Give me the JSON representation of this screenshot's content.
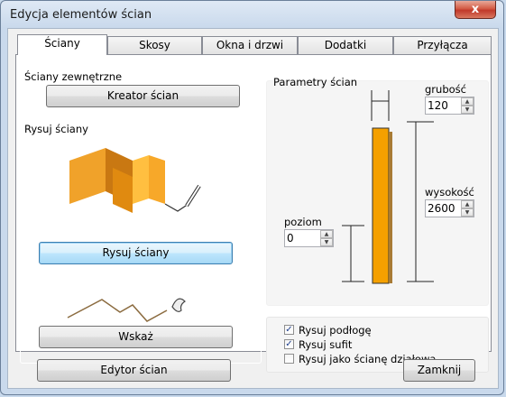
{
  "window": {
    "title": "Edycja elementów ścian",
    "close_glyph": "x"
  },
  "tabs": [
    {
      "label": "Ściany",
      "active": true
    },
    {
      "label": "Skosy",
      "active": false
    },
    {
      "label": "Okna i drzwi",
      "active": false
    },
    {
      "label": "Dodatki",
      "active": false
    },
    {
      "label": "Przyłącza",
      "active": false
    }
  ],
  "exterior_walls": {
    "label": "Ściany zewnętrzne",
    "wizard_button": "Kreator ścian"
  },
  "draw_walls": {
    "label": "Rysuj ściany",
    "draw_button": "Rysuj ściany",
    "point_button": "Wskaż"
  },
  "params": {
    "label": "Parametry ścian",
    "thickness": {
      "label": "grubość",
      "value": "120"
    },
    "height": {
      "label": "wysokość",
      "value": "2600"
    },
    "level": {
      "label": "poziom",
      "value": "0"
    },
    "wall_color": "#f5a000"
  },
  "options": [
    {
      "label": "Rysuj podłogę",
      "checked": true
    },
    {
      "label": "Rysuj sufit",
      "checked": true
    },
    {
      "label": "Rysuj jako ścianę działową",
      "checked": false
    }
  ],
  "footer": {
    "editor_button": "Edytor ścian",
    "close_button": "Zamknij"
  }
}
